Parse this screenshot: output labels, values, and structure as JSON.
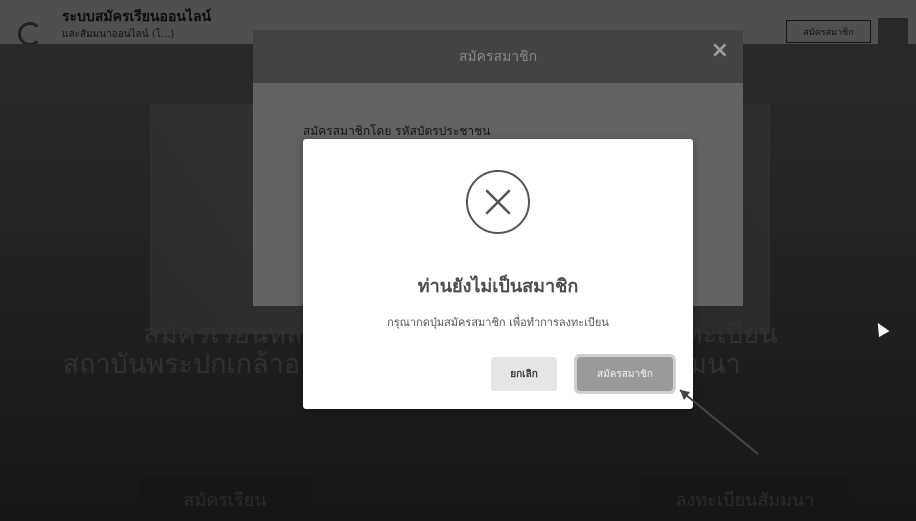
{
  "header": {
    "site_title": "ระบบสมัครเรียนออนไลน์",
    "site_subtitle": "และสัมมนาออนไลน์ (โ...)",
    "register_button": "สมัครสมาชิก"
  },
  "hero": {
    "left_heading_line1": "สมัครเรียนหลั",
    "left_heading_line2": "สถาบันพระปกเกล้าออนไลน์",
    "right_heading_line1": "ลงทะเบียน",
    "right_heading_line2": "สัมมนา",
    "left_button": "สมัครเรียน",
    "right_button": "ลงทะเบียนสัมมนา"
  },
  "register_modal": {
    "title": "สมัครสมาชิก",
    "close_icon": "×",
    "label": "สมัครสมาชิกโดย รหัสบัตรประชาชน"
  },
  "alert": {
    "icon": "x-circle-icon",
    "title": "ท่านยังไม่เป็นสมาชิก",
    "message": "กรุณากดปุ่มสมัครสมาชิก เพื่อทำการลงทะเบียน",
    "cancel_label": "ยกเลิก",
    "register_label": "สมัครสมาชิก"
  },
  "colors": {
    "alert_bg": "#ffffff",
    "icon_stroke": "#555555",
    "cancel_bg": "#e6e6e6",
    "register_bg": "#9a9a9a"
  }
}
